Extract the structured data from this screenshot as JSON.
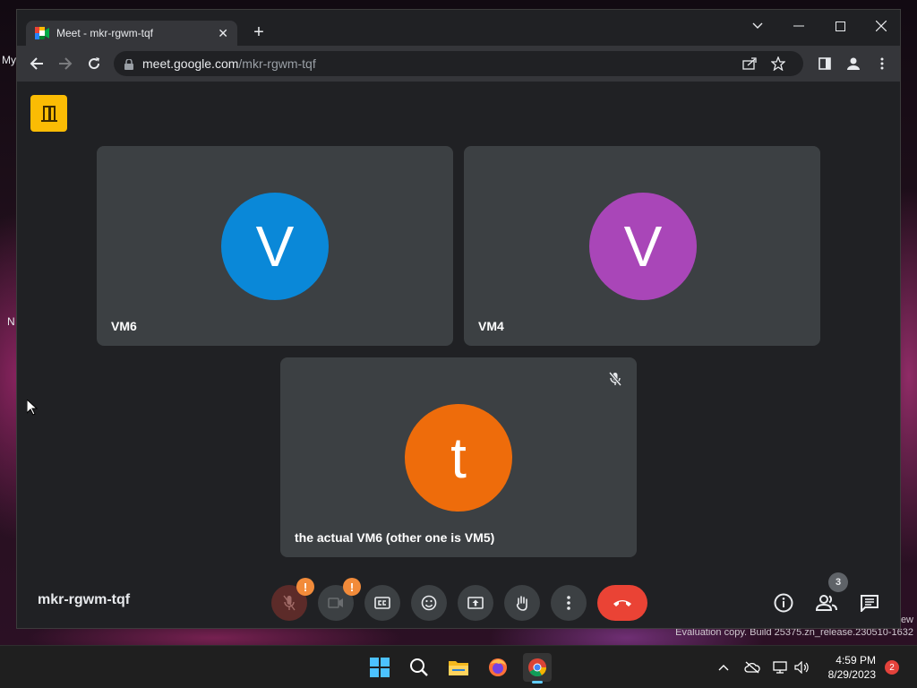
{
  "desktop": {
    "fragment_top_left": "My",
    "fragment_left": "N",
    "watermark_top": "ew",
    "watermark": "Evaluation copy. Build 25375.zn_release.230510-1632"
  },
  "browser": {
    "tab_title": "Meet - mkr-rgwm-tqf",
    "tab_close": "✕",
    "new_tab": "+",
    "url_host": "meet.google.com",
    "url_path": "/mkr-rgwm-tqf"
  },
  "meet": {
    "participants": [
      {
        "initial": "V",
        "name": "VM6",
        "avatar_color": "#0a88d8"
      },
      {
        "initial": "V",
        "name": "VM4",
        "avatar_color": "#a946b8"
      },
      {
        "initial": "t",
        "name": "the actual VM6 (other one is VM5)",
        "avatar_color": "#ee6c0b",
        "muted": true
      }
    ],
    "meeting_code": "mkr-rgwm-tqf",
    "mic_warning": "!",
    "camera_warning": "!",
    "people_count": "3"
  },
  "taskbar": {
    "time": "4:59 PM",
    "date": "8/29/2023",
    "notifications": "2"
  },
  "colors": {
    "meet_bg": "#202124",
    "tile_bg": "#3c4043",
    "hangup": "#ea4335",
    "warning": "#f28b3a",
    "meet_logo": "#fbbc04"
  }
}
